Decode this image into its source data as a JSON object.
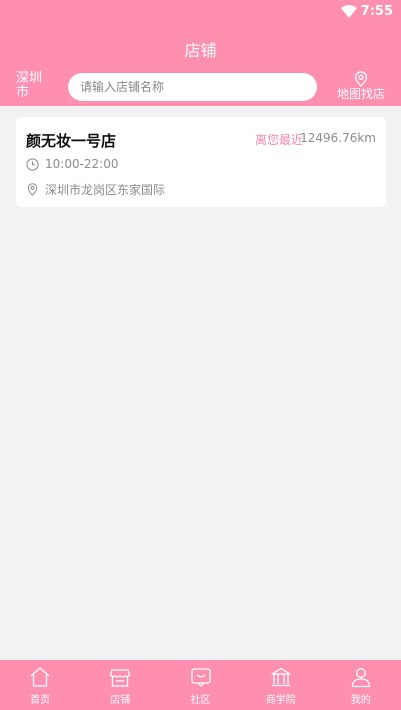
{
  "status_bar": {
    "time": "7:55"
  },
  "header": {
    "title": "店铺",
    "city": "深圳市",
    "search_placeholder": "请输入店铺名称",
    "map_label": "地图找店"
  },
  "stores": [
    {
      "name": "颜无妆一号店",
      "nearest_label": "离您最近",
      "distance": "12496.76km",
      "hours": "10:00-22:00",
      "address": "深圳市龙岗区东家国际"
    }
  ],
  "tabbar": [
    {
      "label": "首页",
      "icon": "home-icon"
    },
    {
      "label": "店铺",
      "icon": "store-icon"
    },
    {
      "label": "社区",
      "icon": "community-icon"
    },
    {
      "label": "商学院",
      "icon": "academy-icon"
    },
    {
      "label": "我的",
      "icon": "profile-icon"
    }
  ],
  "colors": {
    "brand": "#ff8fae",
    "accent_text": "#f08bab",
    "background": "#f2f2f2"
  }
}
